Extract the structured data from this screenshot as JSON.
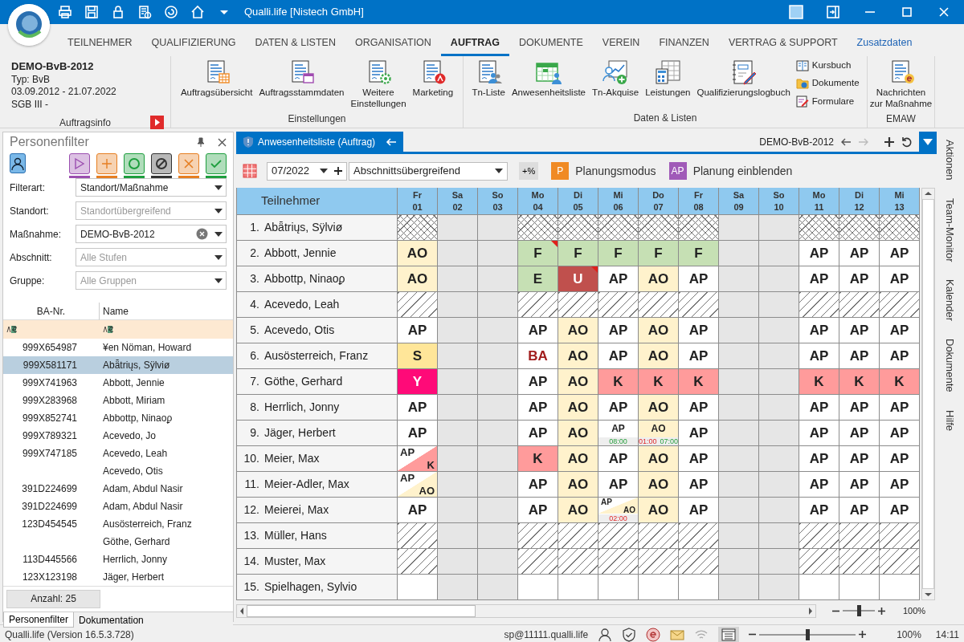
{
  "window": {
    "title": "Qualli.life [Nistech GmbH]"
  },
  "menu_tabs": [
    {
      "label": "TEILNEHMER",
      "selected": false,
      "kind": "tab"
    },
    {
      "label": "QUALIFIZIERUNG",
      "selected": false,
      "kind": "tab"
    },
    {
      "label": "DATEN & LISTEN",
      "selected": false,
      "kind": "tab"
    },
    {
      "label": "ORGANISATION",
      "selected": false,
      "kind": "tab"
    },
    {
      "label": "AUFTRAG",
      "selected": true,
      "kind": "tab"
    },
    {
      "label": "DOKUMENTE",
      "selected": false,
      "kind": "tab"
    },
    {
      "label": "VEREIN",
      "selected": false,
      "kind": "tab"
    },
    {
      "label": "FINANZEN",
      "selected": false,
      "kind": "tab"
    },
    {
      "label": "VERTRAG & SUPPORT",
      "selected": false,
      "kind": "tab"
    },
    {
      "label": "Zusatzdaten",
      "selected": false,
      "kind": "link"
    }
  ],
  "ribbon": {
    "info": {
      "title": "DEMO-BvB-2012",
      "lines": [
        "Typ: BvB",
        "03.09.2012 - 21.07.2022",
        "SGB III -"
      ],
      "group": "Auftragsinfo"
    },
    "groups": [
      {
        "label": "Einstellungen",
        "items": [
          "Auftragsübersicht",
          "Auftragsstammdaten",
          "Weitere\nEinstellungen",
          "Marketing"
        ]
      },
      {
        "label": "Daten & Listen",
        "items": [
          "Tn-Liste",
          "Anwesenheitsliste",
          "Tn-Akquise",
          "Leistungen",
          "Qualifizierungslogbuch"
        ],
        "small_items": [
          "Kursbuch",
          "Dokumente",
          "Formulare"
        ]
      },
      {
        "label": "EMAW",
        "items": [
          "Nachrichten\nzur Maßnahme"
        ]
      }
    ]
  },
  "person_filter": {
    "title": "Personenfilter",
    "status_filters": [
      {
        "color": "#9b4fb0"
      },
      {
        "color": "#e67e22"
      },
      {
        "color": "#1e9e3e"
      },
      {
        "color": "#333333"
      },
      {
        "color": "#e67e22"
      },
      {
        "color": "#1e9e3e"
      }
    ],
    "fields": [
      {
        "label": "Filterart:",
        "value": "Standort/Maßnahme",
        "clearable": false
      },
      {
        "label": "Standort:",
        "placeholder": "Standortübergreifend",
        "clearable": false
      },
      {
        "label": "Maßnahme:",
        "value": "DEMO-BvB-2012",
        "clearable": true
      },
      {
        "label": "Abschnitt:",
        "placeholder": "Alle Stufen",
        "clearable": false
      },
      {
        "label": "Gruppe:",
        "placeholder": "Alle Gruppen",
        "clearable": false
      }
    ],
    "columns": [
      "BA-Nr.",
      "Name"
    ],
    "rows": [
      {
        "ba_nr": "999X654987",
        "name": "¥en Nöman, Howard",
        "selected": false
      },
      {
        "ba_nr": "999X581171",
        "name": "Abǟtriųs, Sÿlviø",
        "selected": true
      },
      {
        "ba_nr": "999X741963",
        "name": "Abbott, Jennie",
        "selected": false
      },
      {
        "ba_nr": "999X283968",
        "name": "Abbott, Miriam",
        "selected": false
      },
      {
        "ba_nr": "999X852741",
        "name": "Abbottp, Ninaoϼ",
        "selected": false
      },
      {
        "ba_nr": "999X789321",
        "name": "Acevedo, Jo",
        "selected": false
      },
      {
        "ba_nr": "999X747185",
        "name": "Acevedo, Leah",
        "selected": false
      },
      {
        "name": "Acevedo, Otis",
        "selected": false
      },
      {
        "ba_nr": "391D224699",
        "name": "Adam, Abdul Nasir",
        "selected": false
      },
      {
        "ba_nr": "391D224699",
        "name": "Adam, Abdul Nasir",
        "selected": false
      },
      {
        "ba_nr": "123D454545",
        "name": "Ausösterreich, Franz",
        "selected": false
      },
      {
        "name": "Göthe, Gerhard",
        "selected": false
      },
      {
        "ba_nr": "113D445566",
        "name": "Herrlich, Jonny",
        "selected": false
      },
      {
        "ba_nr": "123X123198",
        "name": "Jäger, Herbert",
        "selected": false
      }
    ],
    "count": "Anzahl: 25",
    "tabs": [
      {
        "label": "Personenfilter",
        "selected": true
      },
      {
        "label": "Dokumentation",
        "selected": false
      }
    ]
  },
  "attendance": {
    "tab": "Anwesenheitsliste (Auftrag)",
    "context": "DEMO-BvB-2012",
    "month": "07/2022",
    "section": "Abschnittsübergreifend",
    "percent_button": "+%",
    "planning_mode": {
      "badge": "P",
      "label": "Planungsmodus"
    },
    "show_planning": {
      "badge": "AP",
      "label": "Planung einblenden"
    },
    "name_header": "Teilnehmer",
    "days": [
      {
        "day": "Fr",
        "date": "01",
        "weekend": false
      },
      {
        "day": "Sa",
        "date": "02",
        "weekend": true
      },
      {
        "day": "So",
        "date": "03",
        "weekend": true
      },
      {
        "day": "Mo",
        "date": "04",
        "weekend": false
      },
      {
        "day": "Di",
        "date": "05",
        "weekend": false
      },
      {
        "day": "Mi",
        "date": "06",
        "weekend": false
      },
      {
        "day": "Do",
        "date": "07",
        "weekend": false
      },
      {
        "day": "Fr",
        "date": "08",
        "weekend": false
      },
      {
        "day": "Sa",
        "date": "09",
        "weekend": true
      },
      {
        "day": "So",
        "date": "10",
        "weekend": true
      },
      {
        "day": "Mo",
        "date": "11",
        "weekend": false
      },
      {
        "day": "Di",
        "date": "12",
        "weekend": false
      },
      {
        "day": "Mi",
        "date": "13",
        "weekend": false
      }
    ],
    "rows": [
      {
        "number": "1.",
        "name": "Abǟtriųs, Sÿlviø",
        "kind": "cross"
      },
      {
        "number": "2.",
        "name": "Abbott, Jennie",
        "cells": [
          {
            "kind": "code",
            "text": "AO",
            "color": "#fff2cc"
          },
          {
            "kind": "blank"
          },
          {
            "kind": "blank"
          },
          {
            "kind": "code",
            "text": "F",
            "color": "#c6e0b4",
            "flag": true
          },
          {
            "kind": "code",
            "text": "F",
            "color": "#c6e0b4"
          },
          {
            "kind": "code",
            "text": "F",
            "color": "#c6e0b4"
          },
          {
            "kind": "code",
            "text": "F",
            "color": "#c6e0b4"
          },
          {
            "kind": "code",
            "text": "F",
            "color": "#c6e0b4"
          },
          {
            "kind": "blank"
          },
          {
            "kind": "blank"
          },
          {
            "kind": "code",
            "text": "AP",
            "color": "#ffffff"
          },
          {
            "kind": "code",
            "text": "AP",
            "color": "#ffffff"
          },
          {
            "kind": "code",
            "text": "AP",
            "color": "#ffffff"
          }
        ]
      },
      {
        "number": "3.",
        "name": "Abbottp, Ninaoϼ",
        "cells": [
          {
            "kind": "code",
            "text": "AO",
            "color": "#fff2cc"
          },
          {
            "kind": "blank"
          },
          {
            "kind": "blank"
          },
          {
            "kind": "code",
            "text": "E",
            "color": "#c6e0b4"
          },
          {
            "kind": "code",
            "text": "U",
            "color": "#c0504d",
            "flag": true
          },
          {
            "kind": "code",
            "text": "AP",
            "color": "#ffffff"
          },
          {
            "kind": "code",
            "text": "AO",
            "color": "#fff2cc"
          },
          {
            "kind": "code",
            "text": "AP",
            "color": "#ffffff"
          },
          {
            "kind": "blank"
          },
          {
            "kind": "blank"
          },
          {
            "kind": "code",
            "text": "AP",
            "color": "#ffffff"
          },
          {
            "kind": "code",
            "text": "AP",
            "color": "#ffffff"
          },
          {
            "kind": "code",
            "text": "AP",
            "color": "#ffffff"
          }
        ]
      },
      {
        "number": "4.",
        "name": "Acevedo, Leah",
        "kind": "diagonal"
      },
      {
        "number": "5.",
        "name": "Acevedo, Otis",
        "cells": [
          {
            "kind": "code",
            "text": "AP",
            "color": "#ffffff"
          },
          {
            "kind": "blank"
          },
          {
            "kind": "blank"
          },
          {
            "kind": "code",
            "text": "AP",
            "color": "#ffffff"
          },
          {
            "kind": "code",
            "text": "AO",
            "color": "#fff2cc"
          },
          {
            "kind": "code",
            "text": "AP",
            "color": "#ffffff"
          },
          {
            "kind": "code",
            "text": "AO",
            "color": "#fff2cc"
          },
          {
            "kind": "code",
            "text": "AP",
            "color": "#ffffff"
          },
          {
            "kind": "blank"
          },
          {
            "kind": "blank"
          },
          {
            "kind": "code",
            "text": "AP",
            "color": "#ffffff"
          },
          {
            "kind": "code",
            "text": "AP",
            "color": "#ffffff"
          },
          {
            "kind": "code",
            "text": "AP",
            "color": "#ffffff"
          }
        ]
      },
      {
        "number": "6.",
        "name": "Ausösterreich, Franz",
        "cells": [
          {
            "kind": "code",
            "text": "S",
            "color": "#ffe699"
          },
          {
            "kind": "blank"
          },
          {
            "kind": "blank"
          },
          {
            "kind": "alert",
            "text": "BA",
            "color": "#ffffff"
          },
          {
            "kind": "code",
            "text": "AO",
            "color": "#fff2cc"
          },
          {
            "kind": "code",
            "text": "AP",
            "color": "#ffffff"
          },
          {
            "kind": "code",
            "text": "AO",
            "color": "#fff2cc"
          },
          {
            "kind": "code",
            "text": "AP",
            "color": "#ffffff"
          },
          {
            "kind": "blank"
          },
          {
            "kind": "blank"
          },
          {
            "kind": "code",
            "text": "AP",
            "color": "#ffffff"
          },
          {
            "kind": "code",
            "text": "AP",
            "color": "#ffffff"
          },
          {
            "kind": "code",
            "text": "AP",
            "color": "#ffffff"
          }
        ]
      },
      {
        "number": "7.",
        "name": "Göthe, Gerhard",
        "cells": [
          {
            "kind": "code",
            "text": "Y",
            "color": "#ff0a78"
          },
          {
            "kind": "blank"
          },
          {
            "kind": "blank"
          },
          {
            "kind": "code",
            "text": "AP",
            "color": "#ffffff"
          },
          {
            "kind": "code",
            "text": "AO",
            "color": "#fff2cc"
          },
          {
            "kind": "code",
            "text": "K",
            "color": "#ff9b9b"
          },
          {
            "kind": "code",
            "text": "K",
            "color": "#ff9b9b"
          },
          {
            "kind": "code",
            "text": "K",
            "color": "#ff9b9b"
          },
          {
            "kind": "blank"
          },
          {
            "kind": "blank"
          },
          {
            "kind": "code",
            "text": "K",
            "color": "#ff9b9b"
          },
          {
            "kind": "code",
            "text": "K",
            "color": "#ff9b9b"
          },
          {
            "kind": "code",
            "text": "K",
            "color": "#ff9b9b"
          }
        ]
      },
      {
        "number": "8.",
        "name": "Herrlich, Jonny",
        "cells": [
          {
            "kind": "code",
            "text": "AP",
            "color": "#ffffff"
          },
          {
            "kind": "blank"
          },
          {
            "kind": "blank"
          },
          {
            "kind": "code",
            "text": "AP",
            "color": "#ffffff"
          },
          {
            "kind": "code",
            "text": "AO",
            "color": "#fff2cc"
          },
          {
            "kind": "code",
            "text": "AP",
            "color": "#ffffff"
          },
          {
            "kind": "code",
            "text": "AO",
            "color": "#fff2cc"
          },
          {
            "kind": "code",
            "text": "AP",
            "color": "#ffffff"
          },
          {
            "kind": "blank"
          },
          {
            "kind": "blank"
          },
          {
            "kind": "code",
            "text": "AP",
            "color": "#ffffff"
          },
          {
            "kind": "code",
            "text": "AP",
            "color": "#ffffff"
          },
          {
            "kind": "code",
            "text": "AP",
            "color": "#ffffff"
          }
        ]
      },
      {
        "number": "9.",
        "name": "Jäger, Herbert",
        "cells": [
          {
            "kind": "code",
            "text": "AP",
            "color": "#ffffff"
          },
          {
            "kind": "blank"
          },
          {
            "kind": "blank"
          },
          {
            "kind": "code",
            "text": "AP",
            "color": "#ffffff"
          },
          {
            "kind": "code",
            "text": "AO",
            "color": "#fff2cc"
          },
          {
            "kind": "code",
            "text": "AP",
            "color": "#ffffff",
            "times": [
              {
                "text": "08:00",
                "late": false
              }
            ]
          },
          {
            "kind": "code",
            "text": "AO",
            "color": "#fff2cc",
            "times": [
              {
                "text": "01:00",
                "late": true
              },
              {
                "text": "07:00",
                "late": false
              }
            ]
          },
          {
            "kind": "code",
            "text": "AP",
            "color": "#ffffff"
          },
          {
            "kind": "blank"
          },
          {
            "kind": "blank"
          },
          {
            "kind": "code",
            "text": "AP",
            "color": "#ffffff"
          },
          {
            "kind": "code",
            "text": "AP",
            "color": "#ffffff"
          },
          {
            "kind": "code",
            "text": "AP",
            "color": "#ffffff"
          }
        ]
      },
      {
        "number": "10.",
        "name": "Meier, Max",
        "cells": [
          {
            "kind": "split",
            "top": "AP",
            "bottom": "K",
            "color": "#ff9b9b"
          },
          {
            "kind": "blank"
          },
          {
            "kind": "blank"
          },
          {
            "kind": "code",
            "text": "K",
            "color": "#ff9b9b"
          },
          {
            "kind": "code",
            "text": "AO",
            "color": "#fff2cc"
          },
          {
            "kind": "code",
            "text": "AP",
            "color": "#ffffff"
          },
          {
            "kind": "code",
            "text": "AO",
            "color": "#fff2cc"
          },
          {
            "kind": "code",
            "text": "AP",
            "color": "#ffffff"
          },
          {
            "kind": "blank"
          },
          {
            "kind": "blank"
          },
          {
            "kind": "code",
            "text": "AP",
            "color": "#ffffff"
          },
          {
            "kind": "code",
            "text": "AP",
            "color": "#ffffff"
          },
          {
            "kind": "code",
            "text": "AP",
            "color": "#ffffff"
          }
        ]
      },
      {
        "number": "11.",
        "name": "Meier-Adler, Max",
        "cells": [
          {
            "kind": "split",
            "top": "AP",
            "bottom": "AO",
            "color": "#fff2cc"
          },
          {
            "kind": "blank"
          },
          {
            "kind": "blank"
          },
          {
            "kind": "code",
            "text": "AP",
            "color": "#ffffff"
          },
          {
            "kind": "code",
            "text": "AO",
            "color": "#fff2cc"
          },
          {
            "kind": "code",
            "text": "AP",
            "color": "#ffffff"
          },
          {
            "kind": "code",
            "text": "AO",
            "color": "#fff2cc"
          },
          {
            "kind": "code",
            "text": "AP",
            "color": "#ffffff"
          },
          {
            "kind": "blank"
          },
          {
            "kind": "blank"
          },
          {
            "kind": "code",
            "text": "AP",
            "color": "#ffffff"
          },
          {
            "kind": "code",
            "text": "AP",
            "color": "#ffffff"
          },
          {
            "kind": "code",
            "text": "AP",
            "color": "#ffffff"
          }
        ]
      },
      {
        "number": "12.",
        "name": "Meierei, Max",
        "cells": [
          {
            "kind": "code",
            "text": "AP",
            "color": "#ffffff"
          },
          {
            "kind": "blank"
          },
          {
            "kind": "blank"
          },
          {
            "kind": "code",
            "text": "AP",
            "color": "#ffffff"
          },
          {
            "kind": "code",
            "text": "AO",
            "color": "#fff2cc"
          },
          {
            "kind": "split",
            "top": "AP",
            "bottom": "AO",
            "color": "#fff2cc",
            "times": [
              {
                "text": "02:00",
                "late": true
              }
            ]
          },
          {
            "kind": "code",
            "text": "AO",
            "color": "#fff2cc"
          },
          {
            "kind": "code",
            "text": "AP",
            "color": "#ffffff"
          },
          {
            "kind": "blank"
          },
          {
            "kind": "blank"
          },
          {
            "kind": "code",
            "text": "AP",
            "color": "#ffffff"
          },
          {
            "kind": "code",
            "text": "AP",
            "color": "#ffffff"
          },
          {
            "kind": "code",
            "text": "AP",
            "color": "#ffffff"
          }
        ]
      },
      {
        "number": "13.",
        "name": "Müller, Hans",
        "kind": "diagonal"
      },
      {
        "number": "14.",
        "name": "Muster, Max",
        "kind": "diagonal"
      },
      {
        "number": "15.",
        "name": "Spielhagen, Sylvio",
        "cells": [
          {
            "kind": "blank"
          },
          {
            "kind": "blank"
          },
          {
            "kind": "blank"
          },
          {
            "kind": "blank"
          },
          {
            "kind": "blank"
          },
          {
            "kind": "blank"
          },
          {
            "kind": "blank"
          },
          {
            "kind": "blank"
          },
          {
            "kind": "blank"
          },
          {
            "kind": "blank"
          },
          {
            "kind": "blank"
          },
          {
            "kind": "blank"
          },
          {
            "kind": "blank"
          }
        ]
      }
    ],
    "zoom": {
      "level": 0.5,
      "reading": "100%"
    }
  },
  "side_tabs": [
    "Aktionen",
    "Team-Monitor",
    "Kalender",
    "Dokumente",
    "Hilfe"
  ],
  "status_bar": {
    "version": "Qualli.life (Version 16.5.3.728)",
    "user": "sp@11111.qualli.life",
    "zoom": {
      "level": 0.5,
      "reading": "100%"
    },
    "time": "14:11"
  }
}
